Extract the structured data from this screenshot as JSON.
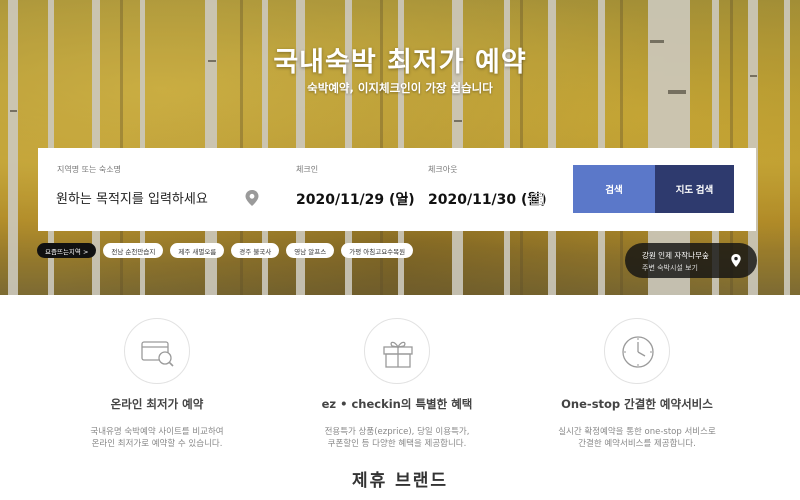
{
  "hero": {
    "title": "국내숙박 최저가 예약",
    "subtitle": "숙박예약, 이지체크인이 가장 쉽습니다"
  },
  "search": {
    "destination_label": "지역명 또는 숙소명",
    "destination_placeholder": "원하는 목적지를 입력하세요",
    "checkin_label": "체크인",
    "checkin_value": "2020/11/29 (일)",
    "date_separator": "–",
    "checkout_label": "체크아웃",
    "checkout_value": "2020/11/30 (월)",
    "search_button": "검색",
    "map_search_button": "지도 검색"
  },
  "tags": {
    "hot_label": "요즘뜨는지역 >",
    "items": [
      "전남 순천만습지",
      "제주 새별오름",
      "경주 불국사",
      "영남 알프스",
      "가평 아침고요수목원"
    ]
  },
  "promo": {
    "line1": "강원 인제 자작나무숲",
    "line2": "주변 숙박시설 보기"
  },
  "features": [
    {
      "icon": "card-search-icon",
      "title": "온라인 최저가 예약",
      "desc": [
        "국내유명 숙박예약 사이트를 비교하여",
        "온라인 최저가로 예약할 수 있습니다."
      ]
    },
    {
      "icon": "gift-icon",
      "title": "ez • checkin의 특별한 혜택",
      "desc": [
        "전용특가 상품(ezprice), 당일 이용특가,",
        "쿠폰할인 등 다양한 혜택을 제공합니다."
      ]
    },
    {
      "icon": "clock-icon",
      "title": "One-stop 간결한 예약서비스",
      "desc": [
        "실시간 확정예약을 통한 one-stop 서비스로",
        "간결한 예약서비스를 제공합니다."
      ]
    }
  ],
  "partner_section": {
    "title": "제휴 브랜드"
  },
  "colors": {
    "search_button": "#5b78c9",
    "map_button": "#2e3a6e"
  }
}
